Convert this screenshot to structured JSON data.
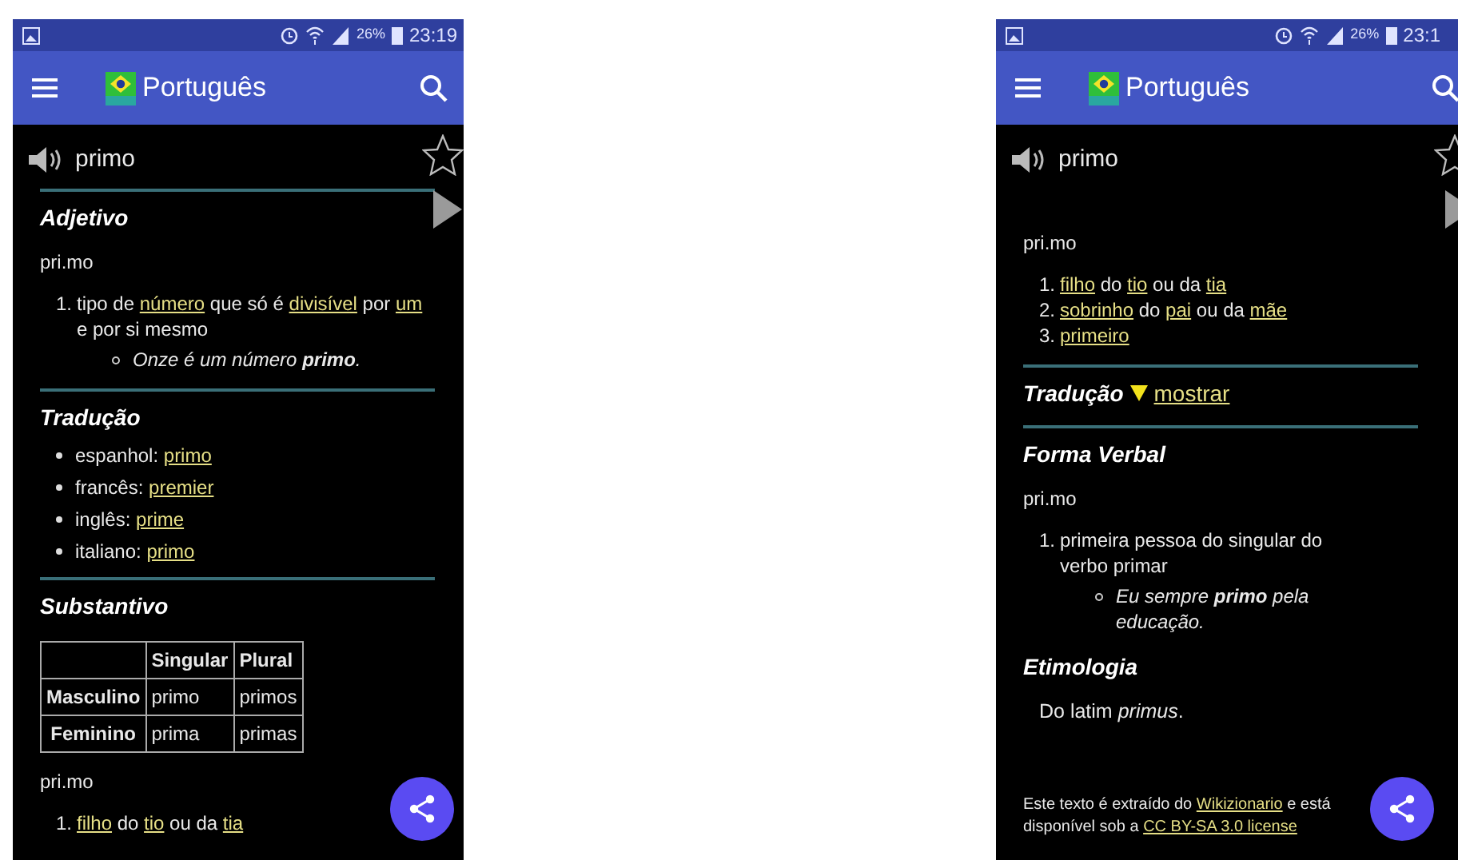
{
  "phones": [
    {
      "status_bar": {
        "battery": "26%",
        "time": "23:19"
      },
      "app_bar": {
        "title": "Português"
      },
      "word": "primo",
      "favorite": false,
      "blocks": [
        {
          "kind": "heading",
          "text": "Adjetivo",
          "rule_above": true
        },
        {
          "kind": "para",
          "text": "pri.mo"
        },
        {
          "kind": "senses",
          "items": [
            {
              "number": "1.",
              "parts": [
                {
                  "text": "tipo de ",
                  "link": false
                },
                {
                  "text": "número",
                  "link": true
                },
                {
                  "text": " que só é ",
                  "link": false
                },
                {
                  "text": "divisível",
                  "link": true
                },
                {
                  "text": " por ",
                  "link": false
                },
                {
                  "text": "um",
                  "link": true
                },
                {
                  "text": " e por si mesmo",
                  "link": false
                }
              ],
              "examples": [
                "Onze é um número **primo**."
              ]
            }
          ]
        },
        {
          "kind": "heading",
          "text": "Tradução",
          "rule_above": true
        },
        {
          "kind": "bullets",
          "items": [
            {
              "parts": [
                {
                  "text": "espanhol: ",
                  "link": false
                },
                {
                  "text": "primo",
                  "link": true
                }
              ]
            },
            {
              "parts": [
                {
                  "text": "francês: ",
                  "link": false
                },
                {
                  "text": "premier",
                  "link": true
                }
              ]
            },
            {
              "parts": [
                {
                  "text": "inglês: ",
                  "link": false
                },
                {
                  "text": "prime",
                  "link": true
                }
              ]
            },
            {
              "parts": [
                {
                  "text": "italiano: ",
                  "link": false
                },
                {
                  "text": "primo",
                  "link": true
                }
              ]
            }
          ]
        },
        {
          "kind": "heading",
          "text": "Substantivo",
          "rule_above": true
        },
        {
          "kind": "table",
          "columns": [
            "Singular",
            "Plural"
          ],
          "rows": [
            {
              "header": "Masculino",
              "cells": [
                "primo",
                "primos"
              ]
            },
            {
              "header": "Feminino",
              "cells": [
                "prima",
                "primas"
              ]
            }
          ]
        },
        {
          "kind": "para",
          "text": "pri.mo"
        },
        {
          "kind": "senses",
          "items": [
            {
              "number": "1.",
              "parts": [
                {
                  "text": "filho",
                  "link": true
                },
                {
                  "text": " do ",
                  "link": false
                },
                {
                  "text": "tio",
                  "link": true
                },
                {
                  "text": " ou da ",
                  "link": false
                },
                {
                  "text": "tia",
                  "link": true
                }
              ]
            }
          ]
        }
      ]
    },
    {
      "status_bar": {
        "battery": "26%",
        "time": "23:1"
      },
      "app_bar": {
        "title": "Português"
      },
      "word": "primo",
      "favorite": false,
      "blocks": [
        {
          "kind": "para",
          "text": "pri.mo"
        },
        {
          "kind": "senses",
          "items": [
            {
              "number": "1.",
              "parts": [
                {
                  "text": "filho",
                  "link": true
                },
                {
                  "text": " do ",
                  "link": false
                },
                {
                  "text": "tio",
                  "link": true
                },
                {
                  "text": " ou da ",
                  "link": false
                },
                {
                  "text": "tia",
                  "link": true
                }
              ]
            },
            {
              "number": "2.",
              "parts": [
                {
                  "text": "sobrinho",
                  "link": true
                },
                {
                  "text": " do ",
                  "link": false
                },
                {
                  "text": "pai",
                  "link": true
                },
                {
                  "text": " ou da ",
                  "link": false
                },
                {
                  "text": "mãe",
                  "link": true
                }
              ]
            },
            {
              "number": "3.",
              "parts": [
                {
                  "text": "primeiro",
                  "link": true
                }
              ]
            }
          ]
        },
        {
          "kind": "heading",
          "text": "Tradução",
          "rule_above": true,
          "toggle": "mostrar",
          "expanded": false
        },
        {
          "kind": "heading",
          "text": "Forma Verbal",
          "rule_above": true
        },
        {
          "kind": "para",
          "text": "pri.mo"
        },
        {
          "kind": "senses",
          "items": [
            {
              "number": "1.",
              "parts": [
                {
                  "text": "primeira pessoa do singular do verbo primar",
                  "link": false
                }
              ],
              "examples": [
                "Eu sempre **primo** pela educação."
              ]
            }
          ]
        },
        {
          "kind": "heading",
          "text": "Etimologia",
          "rule_above": false
        },
        {
          "kind": "note",
          "text": "Do latim *primus*."
        },
        {
          "kind": "footer",
          "parts": [
            {
              "text": "Este texto é extraído do ",
              "link": false
            },
            {
              "text": "Wikizionario",
              "link": true
            },
            {
              "text": " e está disponível sob a ",
              "link": false
            },
            {
              "text": "CC BY-SA 3.0 license",
              "link": true
            }
          ]
        }
      ]
    }
  ]
}
